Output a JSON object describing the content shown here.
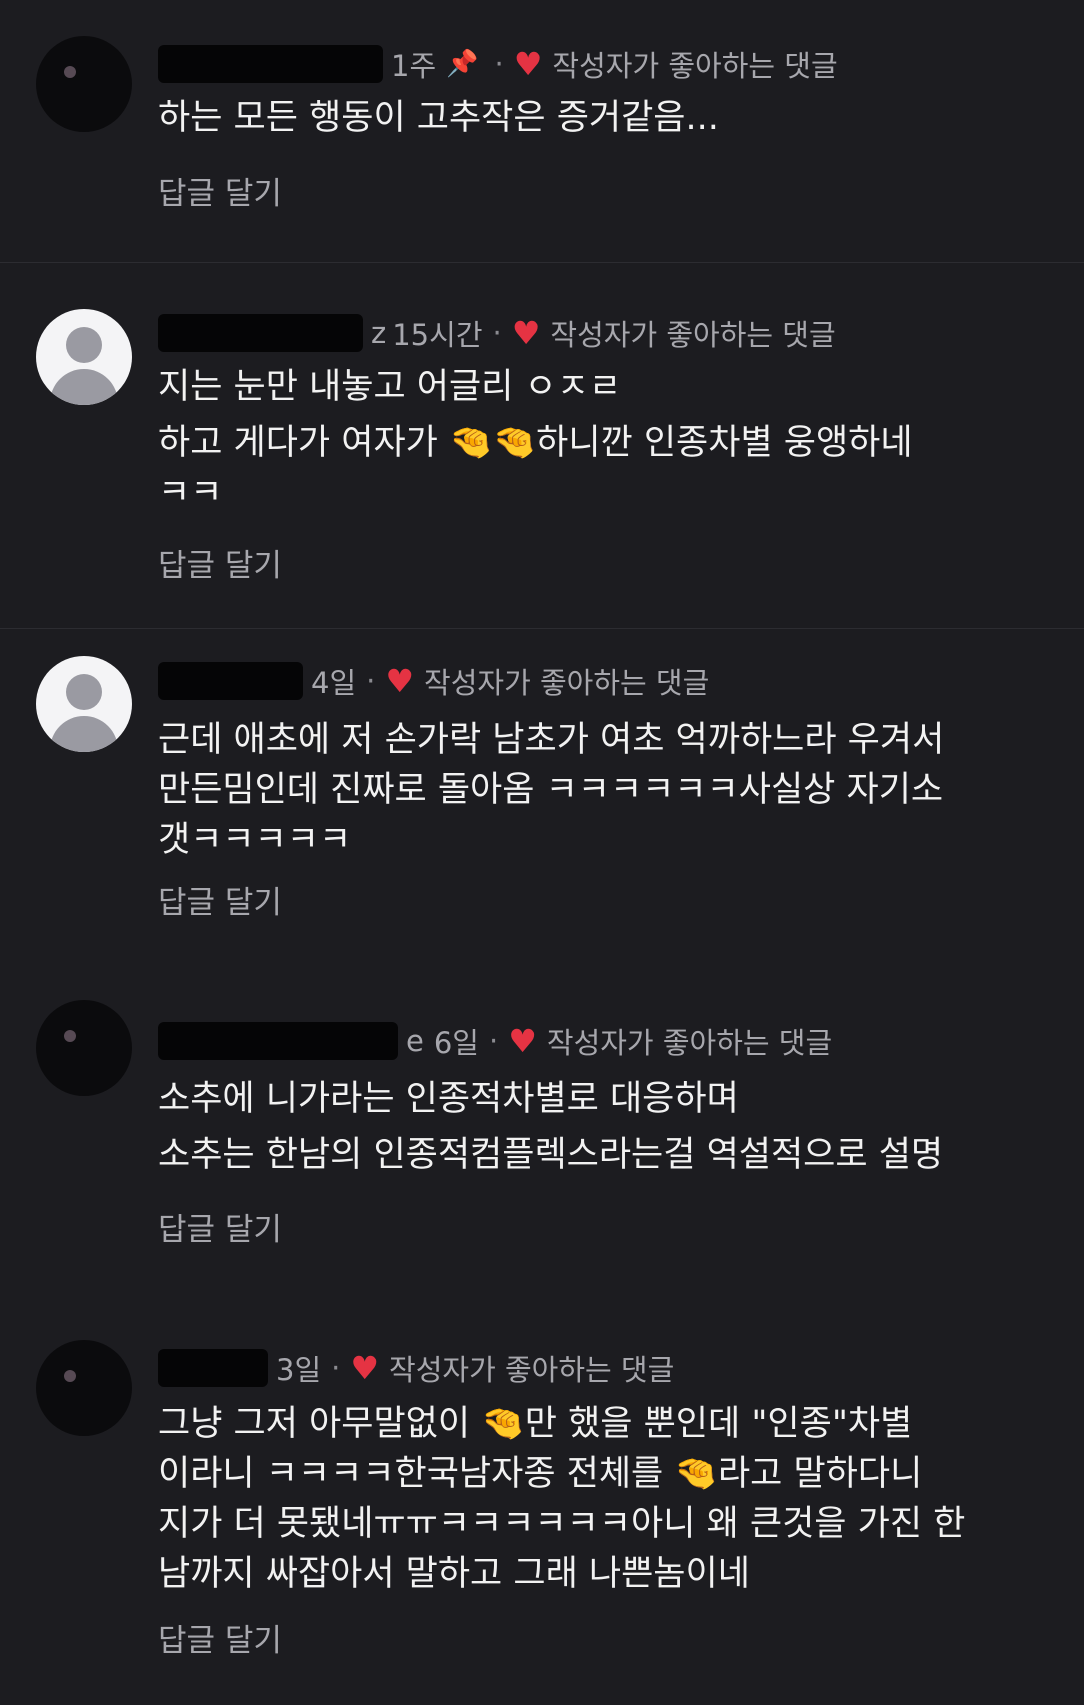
{
  "liked_label": "작성자가 좋아하는 댓글",
  "reply_label": "답글 달기",
  "comments": [
    {
      "author_suffix": "",
      "time": "1주",
      "pinned": true,
      "lines": [
        "하는 모든 행동이 고추작은 증거같음..."
      ]
    },
    {
      "author_suffix": "z",
      "time": "15시간",
      "lines": [
        "지는 눈만 내놓고 어글리 ㅇㅈㄹ",
        "하고 게다가 여자가 🤏🤏하니깐 인종차별 웅앵하네",
        "ㅋㅋ"
      ]
    },
    {
      "author_suffix": "",
      "time": "4일",
      "lines": [
        "근데 애초에 저 손가락 남초가 여초 억까하느라 우겨서",
        "만든밈인데 진짜로 돌아옴 ㅋㅋㅋㅋㅋㅋ사실상 자기소",
        "갯ㅋㅋㅋㅋㅋ"
      ]
    },
    {
      "author_suffix": "e",
      "time": "6일",
      "lines": [
        "소추에 니가라는 인종적차별로 대응하며",
        "소추는 한남의 인종적컴플렉스라는걸 역설적으로 설명"
      ]
    },
    {
      "author_suffix": "",
      "time": "3일",
      "lines": [
        "그냥 그저 아무말없이 🤏만 했을 뿐인데 \"인종\"차별",
        "이라니 ㅋㅋㅋㅋ한국남자종 전체를 🤏라고 말하다니",
        "지가 더 못됐네ㅠㅠㅋㅋㅋㅋㅋㅋ아니 왜 큰것을 가진 한",
        "남까지 싸잡아서 말하고 그래 나쁜놈이네"
      ]
    }
  ],
  "icons": {
    "pin": "pin-icon",
    "heart": "heart-icon",
    "hand": "pinching-hand-icon"
  },
  "colors": {
    "background": "#1c1c20",
    "heart": "#e53343",
    "muted_text": "#a7a7ad"
  }
}
